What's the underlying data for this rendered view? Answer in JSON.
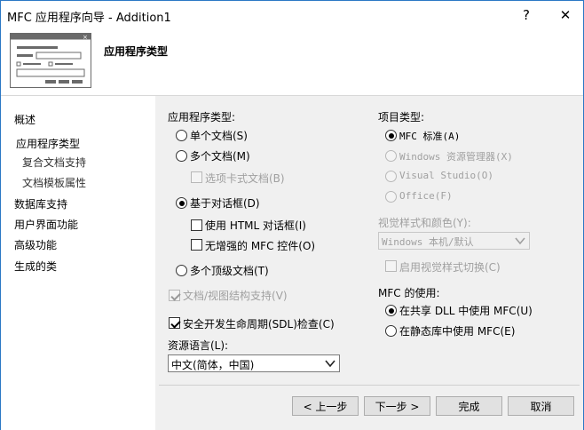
{
  "window": {
    "title": "MFC 应用程序向导 - Addition1",
    "help_label": "?",
    "close_label": "✕"
  },
  "header": {
    "title": "应用程序类型",
    "icon": "dialog-window-icon"
  },
  "sidebar": {
    "items": [
      {
        "label": "概述"
      },
      {
        "label": "应用程序类型"
      },
      {
        "label": "复合文档支持"
      },
      {
        "label": "文档模板属性"
      },
      {
        "label": "数据库支持"
      },
      {
        "label": "用户界面功能"
      },
      {
        "label": "高级功能"
      },
      {
        "label": "生成的类"
      }
    ]
  },
  "app_type": {
    "heading": "应用程序类型:",
    "single_doc": "单个文档(S)",
    "multi_doc": "多个文档(M)",
    "tabbed_docs": "选项卡式文档(B)",
    "dialog_based": "基于对话框(D)",
    "use_html_dialog": "使用 HTML 对话框(I)",
    "no_enhanced_mfc": "无增强的 MFC 控件(O)",
    "multi_toplevel": "多个顶级文档(T)",
    "doc_view_support": "文档/视图结构支持(V)",
    "sdl_checks": "安全开发生命周期(SDL)检查(C)",
    "resource_lang_label": "资源语言(L):",
    "resource_lang_value": "中文(简体，中国)"
  },
  "project_type": {
    "heading": "项目类型:",
    "mfc_standard": "MFC 标准(A)",
    "win_explorer": "Windows 资源管理器(X)",
    "visual_studio": "Visual Studio(O)",
    "office": "Office(F)"
  },
  "visual_style": {
    "label": "视觉样式和颜色(Y):",
    "value": "Windows 本机/默认",
    "enable_switching": "启用视觉样式切换(C)"
  },
  "mfc_use": {
    "heading": "MFC 的使用:",
    "shared_dll": "在共享 DLL 中使用 MFC(U)",
    "static_lib": "在静态库中使用 MFC(E)"
  },
  "buttons": {
    "prev": "< 上一步",
    "next": "下一步 >",
    "finish": "完成",
    "cancel": "取消"
  }
}
